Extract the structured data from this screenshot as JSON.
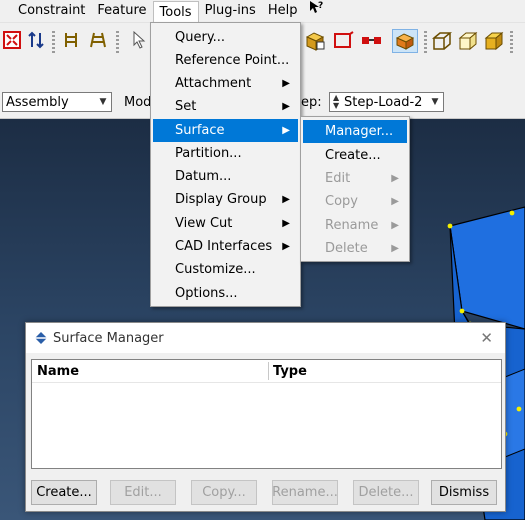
{
  "menubar": {
    "items": [
      {
        "label": "Constraint"
      },
      {
        "label": "Feature"
      },
      {
        "label": "Tools"
      },
      {
        "label": "Plug-ins"
      },
      {
        "label": "Help"
      }
    ],
    "whats_this_icon": "whats-this-icon"
  },
  "toolbar2": {
    "module_combo": "Assembly",
    "model_label": "Mod",
    "step_label": "ep:",
    "step_combo": "Step-Load-2"
  },
  "tools_menu": {
    "items": [
      {
        "label": "Query...",
        "submenu": false
      },
      {
        "label": "Reference Point...",
        "submenu": false
      },
      {
        "label": "Attachment",
        "submenu": true
      },
      {
        "label": "Set",
        "submenu": true
      },
      {
        "label": "Surface",
        "submenu": true,
        "highlighted": true
      },
      {
        "label": "Partition...",
        "submenu": false
      },
      {
        "label": "Datum...",
        "submenu": false
      },
      {
        "label": "Display Group",
        "submenu": true
      },
      {
        "label": "View Cut",
        "submenu": true
      },
      {
        "label": "CAD Interfaces",
        "submenu": true
      },
      {
        "label": "Customize...",
        "submenu": false
      },
      {
        "label": "Options...",
        "submenu": false
      }
    ]
  },
  "surface_submenu": {
    "items": [
      {
        "label": "Manager...",
        "enabled": true,
        "highlighted": true
      },
      {
        "label": "Create...",
        "enabled": true
      },
      {
        "label": "Edit",
        "enabled": false
      },
      {
        "label": "Copy",
        "enabled": false
      },
      {
        "label": "Rename",
        "enabled": false
      },
      {
        "label": "Delete",
        "enabled": false
      }
    ]
  },
  "dialog": {
    "title": "Surface Manager",
    "columns": [
      "Name",
      "Type"
    ],
    "buttons": [
      {
        "label": "Create...",
        "enabled": true
      },
      {
        "label": "Edit...",
        "enabled": false
      },
      {
        "label": "Copy...",
        "enabled": false
      },
      {
        "label": "Rename...",
        "enabled": false
      },
      {
        "label": "Delete...",
        "enabled": false
      },
      {
        "label": "Dismiss",
        "enabled": true
      }
    ]
  },
  "colors": {
    "highlight": "#0078d7",
    "model_blue": "#1b6fd8",
    "vertex_yellow": "#f4f000"
  }
}
